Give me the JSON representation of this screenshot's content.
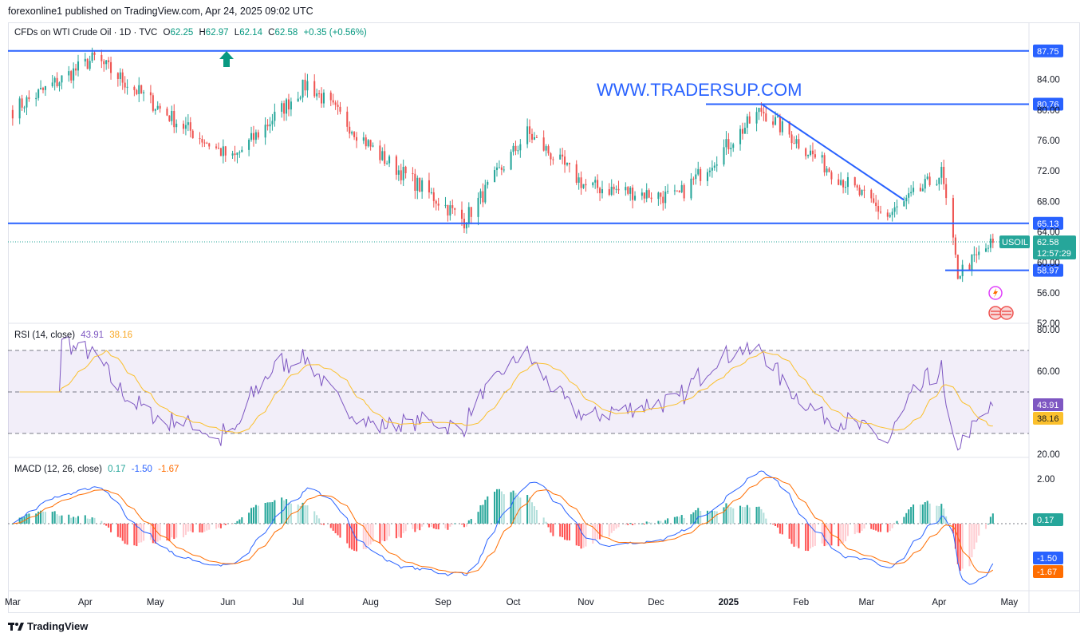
{
  "publisher_line": "forexonline1 published on TradingView.com, Apr 24, 2025 09:02 UTC",
  "symbol_line": {
    "name": "CFDs on WTI Crude Oil · 1D · TVC",
    "open_label": "O",
    "open": "62.25",
    "high_label": "H",
    "high": "62.97",
    "low_label": "L",
    "low": "62.14",
    "close_label": "C",
    "close": "62.58",
    "change": "+0.35 (+0.56%)"
  },
  "watermark": "WWW.TRADERSUP.COM",
  "symbol_tag": "USOIL",
  "price_badge": {
    "price": "62.58",
    "countdown": "12:57:29"
  },
  "rsi_legend": {
    "name": "RSI (14, close)",
    "value": "43.91",
    "ma": "38.16"
  },
  "macd_legend": {
    "name": "MACD (12, 26, close)",
    "macd": "0.17",
    "signal": "-1.50",
    "hist": "-1.67"
  },
  "footer": {
    "brand": "TradingView"
  },
  "colors": {
    "up": "#26a69a",
    "down": "#ef5350",
    "level": "#2962ff",
    "rsi": "#7e57c2",
    "rsi_ma": "#fbc02d",
    "macd": "#2962ff",
    "signal": "#ff6d00"
  },
  "chart_data": [
    {
      "type": "candlestick",
      "title": "CFDs on WTI Crude Oil · 1D · TVC",
      "x_ticks": [
        "Mar",
        "Apr",
        "May",
        "Jun",
        "Jul",
        "Aug",
        "Sep",
        "Oct",
        "Nov",
        "Dec",
        "2025",
        "Feb",
        "Mar",
        "Apr",
        "May"
      ],
      "y_ticks": [
        "84.00",
        "80.00",
        "76.00",
        "72.00",
        "68.00",
        "64.00",
        "60.00",
        "56.00",
        "52.00"
      ],
      "ylim": [
        52,
        88
      ],
      "horizontal_levels": [
        {
          "value": 87.75,
          "label": "87.75"
        },
        {
          "value": 80.76,
          "label": "80.76"
        },
        {
          "value": 65.13,
          "label": "65.13"
        },
        {
          "value": 58.97,
          "label": "58.97"
        }
      ],
      "trendline": {
        "from": [
          "2025-01-15",
          80.8
        ],
        "to": [
          "2025-03-17",
          68.2
        ]
      },
      "key_points": [
        {
          "date": "2024-03-01",
          "close": 80.0
        },
        {
          "date": "2024-04-05",
          "close": 86.8
        },
        {
          "date": "2024-05-10",
          "close": 78.5
        },
        {
          "date": "2024-06-03",
          "close": 73.5
        },
        {
          "date": "2024-07-05",
          "close": 83.5
        },
        {
          "date": "2024-08-05",
          "close": 74.0
        },
        {
          "date": "2024-09-10",
          "close": 65.5
        },
        {
          "date": "2024-10-07",
          "close": 77.0
        },
        {
          "date": "2024-11-01",
          "close": 70.0
        },
        {
          "date": "2024-12-10",
          "close": 68.5
        },
        {
          "date": "2025-01-15",
          "close": 80.0
        },
        {
          "date": "2025-02-10",
          "close": 73.0
        },
        {
          "date": "2025-03-10",
          "close": 66.0
        },
        {
          "date": "2025-04-02",
          "close": 71.7
        },
        {
          "date": "2025-04-09",
          "close": 58.5
        },
        {
          "date": "2025-04-24",
          "close": 62.58
        }
      ]
    },
    {
      "type": "line",
      "title": "RSI (14, close)",
      "y_ticks": [
        "80.00",
        "60.00",
        "20.00"
      ],
      "ylim": [
        20,
        80
      ],
      "bands": [
        70,
        50,
        30
      ],
      "series": [
        {
          "name": "RSI",
          "last": 43.91
        },
        {
          "name": "MA",
          "last": 38.16
        }
      ]
    },
    {
      "type": "line",
      "title": "MACD (12, 26, close)",
      "y_ticks": [
        "2.00"
      ],
      "series": [
        {
          "name": "MACD",
          "last": -1.5
        },
        {
          "name": "Signal",
          "last": -1.67
        },
        {
          "name": "Histogram",
          "last": 0.17
        }
      ]
    }
  ]
}
